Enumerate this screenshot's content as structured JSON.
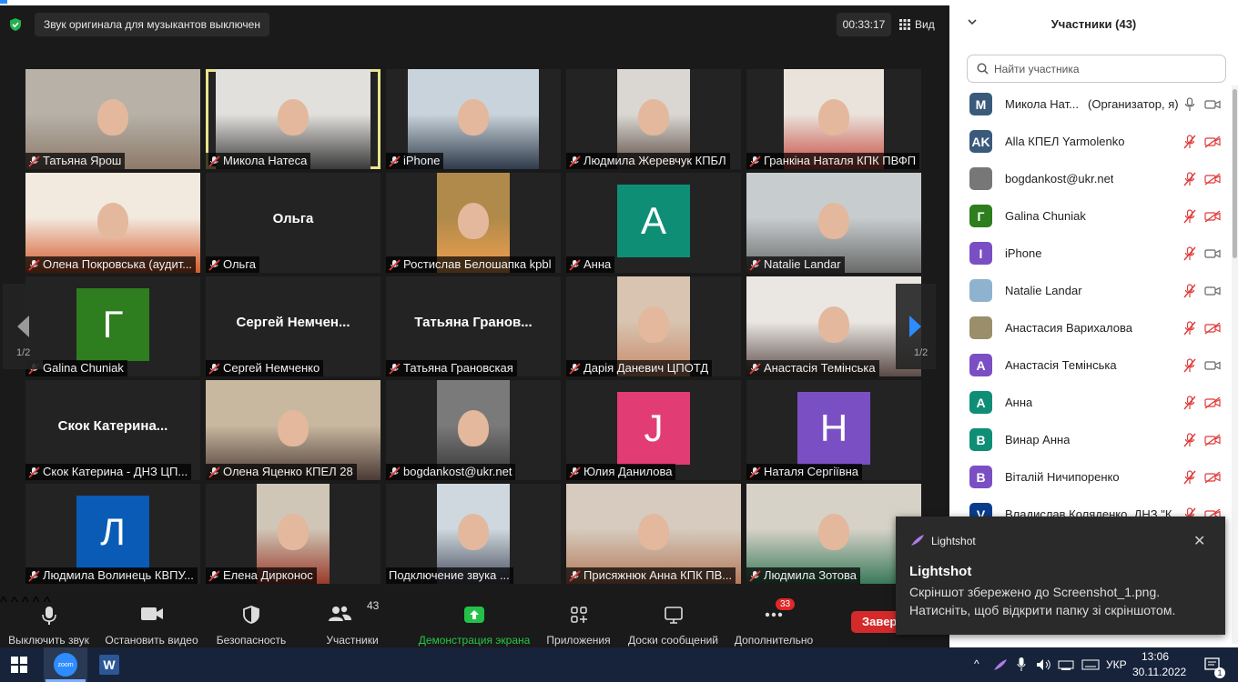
{
  "meeting": {
    "music_banner": "Звук оригинала для музыкантов выключен",
    "timer": "00:33:17",
    "view_label": "Вид",
    "page_indicator": "1/2",
    "tiles": [
      {
        "name": "Татьяна Ярош",
        "type": "video"
      },
      {
        "name": "Микола Натеса",
        "type": "video",
        "active_speaker": true
      },
      {
        "name": "iPhone",
        "type": "video"
      },
      {
        "name": "Людмила Жеревчук  КПБЛ",
        "type": "video"
      },
      {
        "name": "Гранкіна Наталя КПК ПВФП",
        "type": "video"
      },
      {
        "name": "Олена Покровська (аудит...",
        "type": "video"
      },
      {
        "name": "Ольга",
        "type": "name",
        "display": "Ольга"
      },
      {
        "name": "Ростислав Белошапка kpbl",
        "type": "photo"
      },
      {
        "name": "Анна",
        "type": "avatar",
        "letter": "А",
        "color": "#0f8e76"
      },
      {
        "name": "Natalie Landar",
        "type": "video"
      },
      {
        "name": "Galina Chuniak",
        "type": "avatar",
        "letter": "Г",
        "color": "#2e7d1f"
      },
      {
        "name": "Сергей Немченко",
        "type": "name",
        "display": "Сергей  Немчен..."
      },
      {
        "name": "Татьяна Грановская",
        "type": "name",
        "display": "Татьяна  Гранов..."
      },
      {
        "name": "Дарія Даневич ЦПОТД",
        "type": "photo"
      },
      {
        "name": "Анастасія Темінська",
        "type": "video"
      },
      {
        "name": "Скок Катерина - ДНЗ ЦП...",
        "type": "name",
        "display": "Скок  Катерина..."
      },
      {
        "name": "Олена Яценко КПЕЛ 28",
        "type": "video"
      },
      {
        "name": "bogdankost@ukr.net",
        "type": "photo"
      },
      {
        "name": "Юлия Данилова",
        "type": "avatar",
        "letter": "J",
        "color": "#e23c75"
      },
      {
        "name": "Наталя Сергіївна",
        "type": "avatar",
        "letter": "Н",
        "color": "#7b4fc4"
      },
      {
        "name": "Людмила Волинець КВПУ...",
        "type": "avatar",
        "letter": "Л",
        "color": "#0a5bb5"
      },
      {
        "name": "Елена Дирконос",
        "type": "photo"
      },
      {
        "name": "Подключение звука ...",
        "type": "photo",
        "connecting": true
      },
      {
        "name": "Присяжнюк Анна КПК ПВ...",
        "type": "video"
      },
      {
        "name": "Людмила Зотова",
        "type": "video"
      }
    ]
  },
  "toolbar": {
    "mute": "Выключить звук",
    "video": "Остановить видео",
    "security": "Безопасность",
    "participants": "Участники",
    "participants_count": "43",
    "share": "Демонстрация экрана",
    "apps": "Приложения",
    "whiteboards": "Доски сообщений",
    "more": "Дополнительно",
    "more_badge": "33",
    "end": "Завершить"
  },
  "panel": {
    "title": "Участники (43)",
    "search_placeholder": "Найти участника",
    "participants": [
      {
        "name": "Микола Нат...",
        "role": "(Организатор, я)",
        "initials": "M",
        "color": "#3a5a7c",
        "muted": false,
        "video": true
      },
      {
        "name": "Alla КПЕЛ Yarmolenko",
        "initials": "AK",
        "color": "#3a5a7c",
        "muted": true,
        "video": false
      },
      {
        "name": "bogdankost@ukr.net",
        "initials": "",
        "color": "#777777",
        "muted": true,
        "video": false,
        "photo": true
      },
      {
        "name": "Galina Chuniak",
        "initials": "Г",
        "color": "#2e7d1f",
        "muted": true,
        "video": false
      },
      {
        "name": "iPhone",
        "initials": "I",
        "color": "#7b4fc4",
        "muted": true,
        "video": true
      },
      {
        "name": "Natalie Landar",
        "initials": "",
        "color": "#8fb3cf",
        "muted": true,
        "video": true,
        "photo": true
      },
      {
        "name": "Анастасия Варихалова",
        "initials": "",
        "color": "#9a8f6a",
        "muted": true,
        "video": false,
        "photo": true
      },
      {
        "name": "Анастасія Темінська",
        "initials": "А",
        "color": "#7b4fc4",
        "muted": true,
        "video": true
      },
      {
        "name": "Анна",
        "initials": "А",
        "color": "#0f8e76",
        "muted": true,
        "video": false
      },
      {
        "name": "Винар Анна",
        "initials": "В",
        "color": "#0f8e76",
        "muted": true,
        "video": false
      },
      {
        "name": "Віталій Ничипоренко",
        "initials": "В",
        "color": "#7b4fc4",
        "muted": true,
        "video": false
      },
      {
        "name": "Владислав Коляденко, ДНЗ \"К...",
        "initials": "V",
        "color": "#0a3c8c",
        "muted": true,
        "video": false
      }
    ]
  },
  "toast": {
    "app": "Lightshot",
    "title": "Lightshot",
    "body": "Скріншот збережено до Screenshot_1.png. Натисніть, щоб відкрити папку зі скріншотом."
  },
  "taskbar": {
    "zoom_label": "zoom",
    "lang": "УКР",
    "time": "13:06",
    "date": "30.11.2022",
    "notification_count": "1"
  }
}
